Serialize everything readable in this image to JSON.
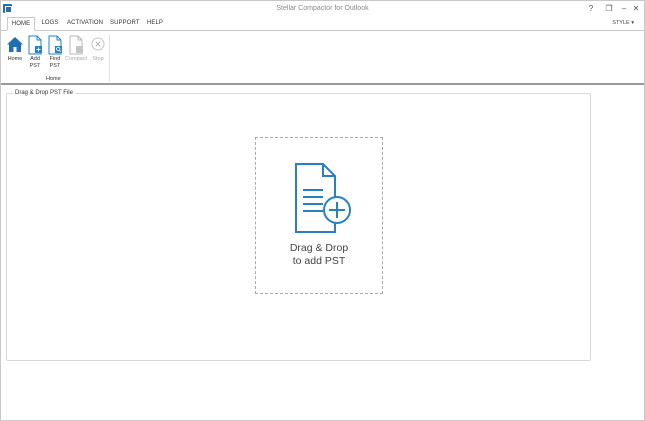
{
  "window": {
    "title": "Stellar Compactor for Outlook",
    "controls": {
      "help": "?",
      "restore": "❐",
      "minimize": "–",
      "close": "✕"
    }
  },
  "ribbon": {
    "tabs": [
      {
        "label": "HOME",
        "active": true
      },
      {
        "label": "LOGS",
        "active": false
      },
      {
        "label": "ACTIVATION",
        "active": false
      },
      {
        "label": "SUPPORT",
        "active": false
      },
      {
        "label": "HELP",
        "active": false
      }
    ],
    "style_label": "STYLE ▾",
    "buttons": [
      {
        "label_line1": "Home",
        "label_line2": "",
        "icon": "home-icon",
        "enabled": true
      },
      {
        "label_line1": "Add",
        "label_line2": "PST",
        "icon": "add-file-icon",
        "enabled": true
      },
      {
        "label_line1": "Find",
        "label_line2": "PST",
        "icon": "find-file-icon",
        "enabled": true
      },
      {
        "label_line1": "Compact",
        "label_line2": "",
        "icon": "compact-icon",
        "enabled": false
      },
      {
        "label_line1": "Stop",
        "label_line2": "",
        "icon": "stop-icon",
        "enabled": false
      }
    ],
    "group_label": "Home"
  },
  "main": {
    "panel_title": "Drag & Drop PST File",
    "dropzone": {
      "icon": "file-add-icon",
      "line1": "Drag & Drop",
      "line2": "to add PST"
    }
  },
  "colors": {
    "accent": "#1f6fb2",
    "icon_blue": "#2a7fc0",
    "disabled": "#a8a8a8",
    "border": "#c9c9c9"
  }
}
